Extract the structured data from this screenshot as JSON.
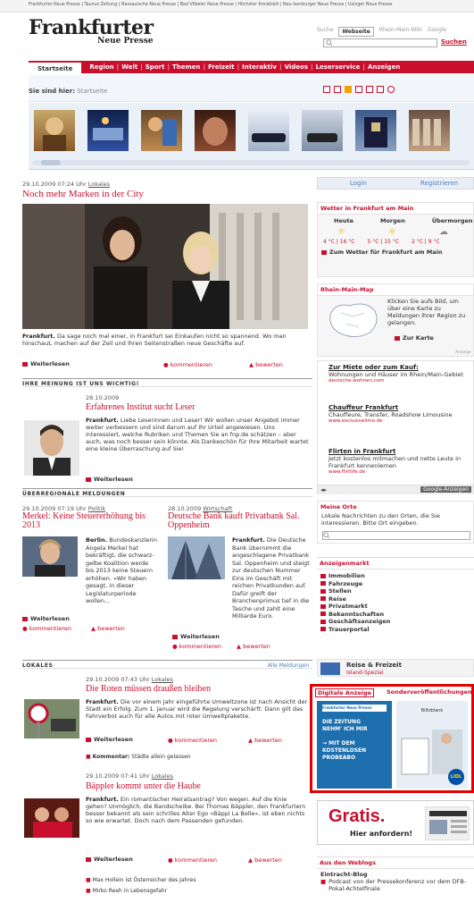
{
  "topbar": {
    "links": "Frankfurter Neue Presse | Taunus Zeitung | Nassauische Neue Presse | Bad Vilbeler Neue Presse | Höchster Kreisblatt | Neu-Isenburger Neue Presse | Usinger Neue Presse"
  },
  "logo": {
    "line1": "Frankfurter",
    "line2": "Neue Presse"
  },
  "search": {
    "tabs": [
      "Suche",
      "Webseite",
      "Rhein-Main-Wiki",
      "Google"
    ],
    "placeholder": "",
    "button": "Suchen"
  },
  "nav": {
    "home": "Startseite",
    "items": [
      "Region",
      "Welt",
      "Sport",
      "Themen",
      "Freizeit",
      "Interaktiv",
      "Videos",
      "Leserservice",
      "Anzeigen"
    ]
  },
  "breadcrumb": {
    "label": "Sie sind hier:",
    "current": "Startseite"
  },
  "hero": {
    "date": "29.10.2009 07:24 Uhr",
    "category": "Lokales",
    "title": "Noch mehr Marken in der City",
    "lead_bold": "Frankfurt.",
    "lead": "Da sage noch mal einer, in Frankfurt sei Einkaufen nicht so spannend. Wo man hinschaut, machen auf der Zeil und ihren Seitenstraßen neue Geschäfte auf.",
    "more": "Weiterlesen",
    "comment": "kommentieren",
    "rate": "bewerten"
  },
  "opinion": {
    "section": "IHRE MEINUNG IST UNS WICHTIG!",
    "date": "28.10.2009",
    "title": "Erfahrenes Institut sucht Leser",
    "lead_bold": "Frankfurt.",
    "lead": "Liebe Leserinnen und Leser! Wir wollen unser Angebot immer weiter verbessern und sind darum auf Ihr Urteil angewiesen. Uns interessiert, welche Rubriken und Themen Sie an fnp.de schätzen – aber auch, was noch besser sein könnte. Als Dankeschön für Ihre Mitarbeit wartet eine kleine Überraschung auf Sie!",
    "more": "Weiterlesen"
  },
  "national": {
    "section": "ÜBERREGIONALE MELDUNGEN",
    "left": {
      "date": "29.10.2009 07:19 Uhr",
      "category": "Politik",
      "title": "Merkel: Keine Steuererhöhung bis 2013",
      "lead_bold": "Berlin.",
      "lead": "Bundeskanzlerin Angela Merkel hat bekräftigt, die schwarz-gelbe Koalition werde bis 2013 keine Steuern erhöhen. «Wir haben gesagt, in dieser Legislaturperiode wollen...",
      "more": "Weiterlesen",
      "comment": "kommentieren",
      "rate": "bewerten"
    },
    "right": {
      "date": "28.10.2009",
      "category": "Wirtschaft",
      "title": "Deutsche Bank kauft Privatbank Sal. Oppenheim",
      "lead_bold": "Frankfurt.",
      "lead": "Die Deutsche Bank übernimmt die angeschlagene Privatbank Sal. Oppenheim und steigt zur deutschen Nummer Eins im Geschäft mit reichen Privatkunden auf. Dafür greift der Branchenprimus tief in die Tasche und zahlt eine Milliarde Euro.",
      "more": "Weiterlesen",
      "comment": "kommentieren",
      "rate": "bewerten"
    }
  },
  "local": {
    "section": "LOKALES",
    "all": "Alle Meldungen",
    "items": [
      {
        "date": "29.10.2009 07:43 Uhr",
        "category": "Lokales",
        "title": "Die Roten müssen draußen bleiben",
        "lead_bold": "Frankfurt.",
        "lead": "Die vor einem Jahr eingeführte Umweltzone ist nach Ansicht der Stadt ein Erfolg. Zum 1. Januar wird die Regelung verschärft: Dann gilt das Fahrverbot auch für alle Autos mit roter Umweltplakette.",
        "more": "Weiterlesen",
        "comment": "kommentieren",
        "rate": "bewerten",
        "comment_label": "Kommentar:",
        "comment_text": "Städte allein gelassen"
      },
      {
        "date": "29.10.2009 07:41 Uhr",
        "category": "Lokales",
        "title": "Bäppler kommt unter die Haube",
        "lead_bold": "Frankfurt.",
        "lead": "Ein romantischer Heiratsantrag? Von wegen. Auf die Knie gehen? Unmöglich, die Bandscheibe. Bei Thomas Bäppler, den Frankfurtern besser bekannt als sein schrilles Alter Ego «Bäppi La Belle», ist eben nichts so wie erwartet. Doch nach dem Passenden gefunden.",
        "more": "Weiterlesen",
        "comment": "kommentieren",
        "rate": "bewerten"
      }
    ],
    "extra": [
      "Max Hollein ist Österreicher des Jahres",
      "Mirko Reeh in Lebensgefahr"
    ]
  },
  "sidebar": {
    "login": "Login",
    "register": "Registrieren",
    "weather": {
      "title": "Wetter in Frankfurt am Main",
      "days": [
        "Heute",
        "Morgen",
        "Übermorgen"
      ],
      "temps": [
        "4 °C | 16 °C",
        "5 °C | 15 °C",
        "2 °C | 9 °C"
      ],
      "link": "Zum Wetter für Frankfurt am Main"
    },
    "map": {
      "title": "Rhein-Main-Map",
      "text": "Klicken Sie aufs Bild, um über eine Karte zu Meldungen Ihrer Region zu gelangen.",
      "link": "Zur Karte",
      "adlabel": "Anzeige"
    },
    "ads": [
      {
        "title": "Zur Miete oder zum Kauf:",
        "text": "Wohnungen und Häuser im Rhein/Main-Gebiet",
        "url": "deutsche-wohnen.com"
      },
      {
        "title": "Chauffeur Frankfurt",
        "text": "Chauffeure, Transfer, Roadshow Limousine",
        "url": "www.exclusivelimo.de"
      },
      {
        "title": "Flirten in Frankfurt",
        "text": "Jetzt kostenlos mitmachen und nette Leute in Frankfurt kennenlernen",
        "url": "www.flirtlife.de"
      }
    ],
    "google": "Google-Anzeigen",
    "places": {
      "title": "Meine Orte",
      "text": "Lokale Nachrichten zu den Orten, die Sie interessieren. Bitte Ort eingeben."
    },
    "market": {
      "title": "Anzeigenmarkt",
      "items": [
        "Immobilien",
        "Fahrzeuge",
        "Stellen",
        "Reise",
        "Privatmarkt",
        "Bekanntschaften",
        "Geschäftsanzeigen",
        "Trauerportal"
      ]
    },
    "travel": {
      "title": "Reise & Freizeit",
      "sub": "Island-Spezial"
    },
    "digital": {
      "tab1": "Digitale Anzeige",
      "tab2": "Sonderveröffentlichungen",
      "ad1_line1": "DIE ZEITUNG",
      "ad1_line2": "NEHM' ICH MIR",
      "ad1_line3": "→ MIT DEM",
      "ad1_line4": "KOSTENLOSEN",
      "ad1_line5": "PROBEABO",
      "ad1_top": "Frankfurter Neue Presse",
      "ad2_label": "Biltzblank",
      "lidl": "LIDL"
    },
    "gratis": {
      "big": "Gratis.",
      "small": "Hier anfordern!"
    },
    "weblogs": {
      "title": "Aus den Weblogs",
      "blog": "Eintracht-Blog",
      "item": "Podcast von der Pressekonferenz vor dem DFB-Pokal-Achtelfinale"
    }
  }
}
